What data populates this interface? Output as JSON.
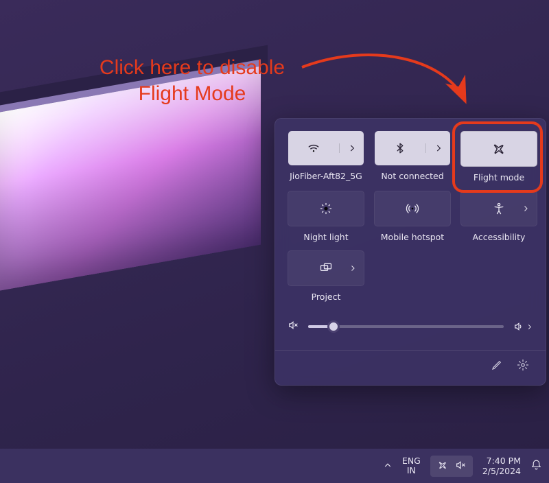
{
  "annotation": {
    "line1": "Click here to disable",
    "line2": "Flight Mode"
  },
  "quick_settings": {
    "tiles": {
      "wifi": {
        "label": "JioFiber-Aft82_5G"
      },
      "bluetooth": {
        "label": "Not connected"
      },
      "flight_mode": {
        "label": "Flight mode"
      },
      "night_light": {
        "label": "Night light"
      },
      "hotspot": {
        "label": "Mobile hotspot"
      },
      "accessibility": {
        "label": "Accessibility"
      },
      "project": {
        "label": "Project"
      }
    },
    "volume": {
      "muted": true,
      "value_pct": 13
    }
  },
  "taskbar": {
    "language_top": "ENG",
    "language_bottom": "IN",
    "time": "7:40 PM",
    "date": "2/5/2024"
  }
}
